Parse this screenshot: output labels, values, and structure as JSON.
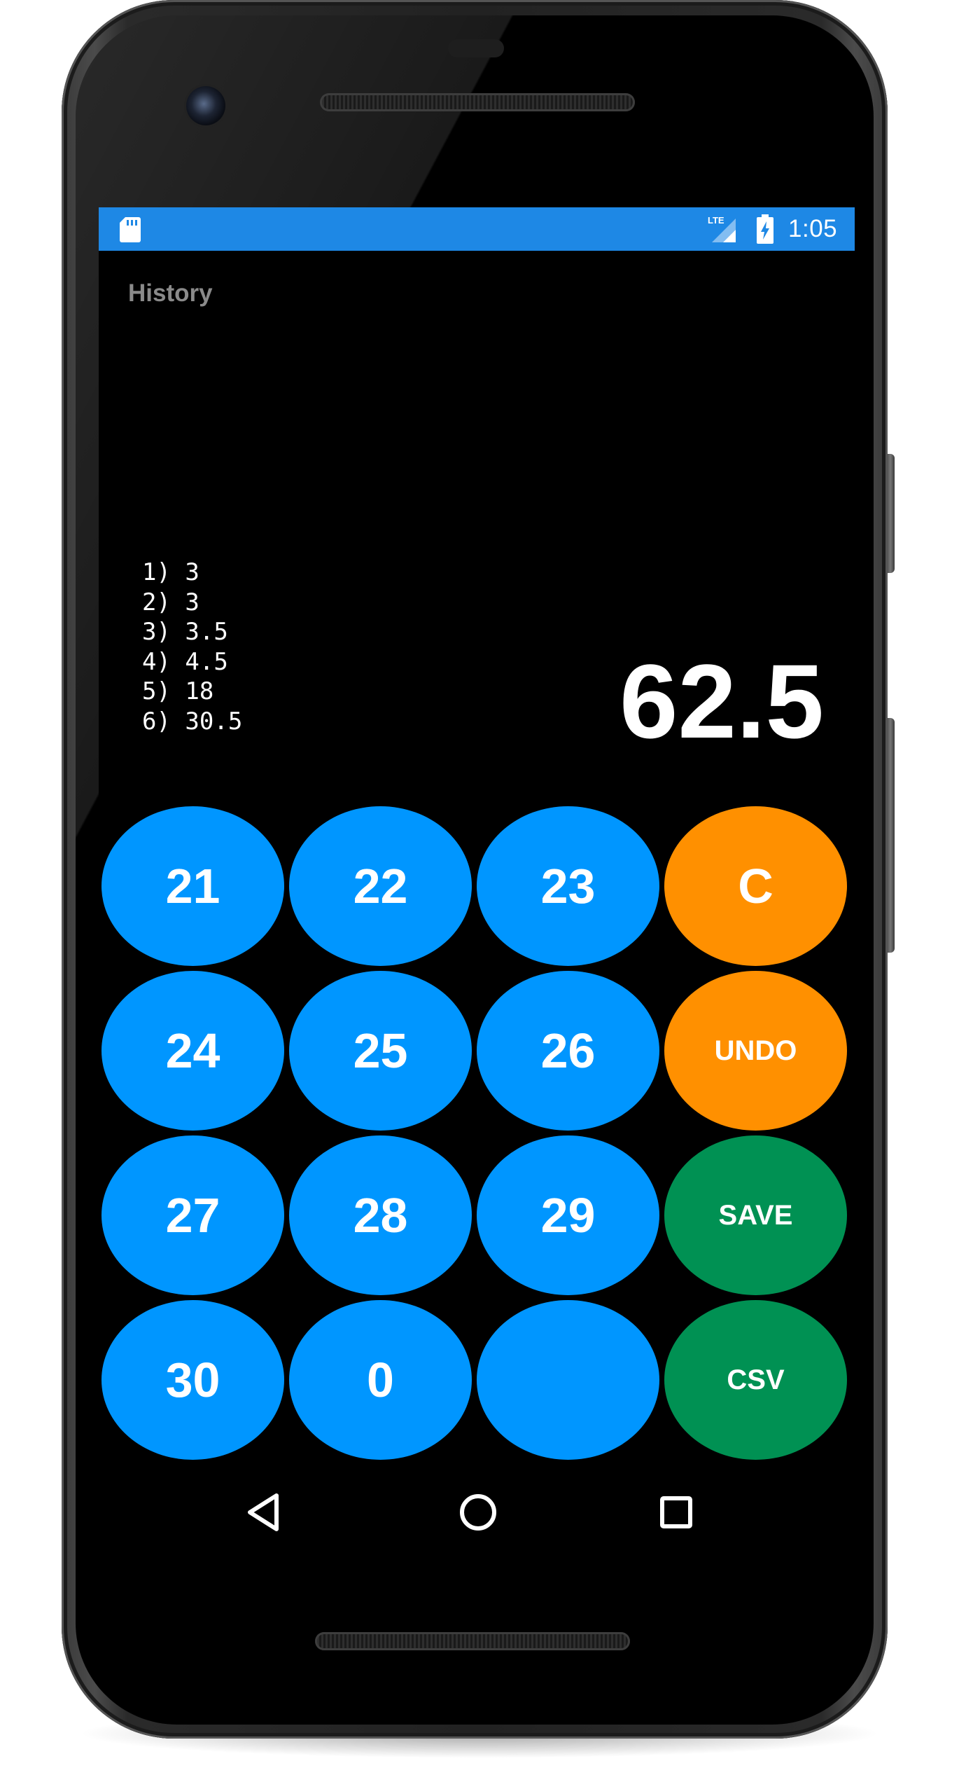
{
  "status_bar": {
    "time": "1:05",
    "background_color": "#1e88e5",
    "icons": [
      "sd-card-icon",
      "lte-signal-icon",
      "battery-charging-icon"
    ],
    "network_label": "LTE"
  },
  "history": {
    "title": "History",
    "entries": [
      "1) 3",
      "2) 3",
      "3) 3.5",
      "4) 4.5",
      "5) 18",
      "6) 30.5"
    ]
  },
  "display": {
    "value": "62.5"
  },
  "keypad": {
    "colors": {
      "number": "#0096ff",
      "action_orange": "#ff9000",
      "action_green": "#009153"
    },
    "rows": [
      [
        "21",
        "22",
        "23",
        "C"
      ],
      [
        "24",
        "25",
        "26",
        "UNDO"
      ],
      [
        "27",
        "28",
        "29",
        "SAVE"
      ],
      [
        "30",
        "0",
        "",
        "CSV"
      ]
    ]
  },
  "nav_bar": {
    "icons": [
      "back-icon",
      "home-icon",
      "recents-icon"
    ]
  }
}
